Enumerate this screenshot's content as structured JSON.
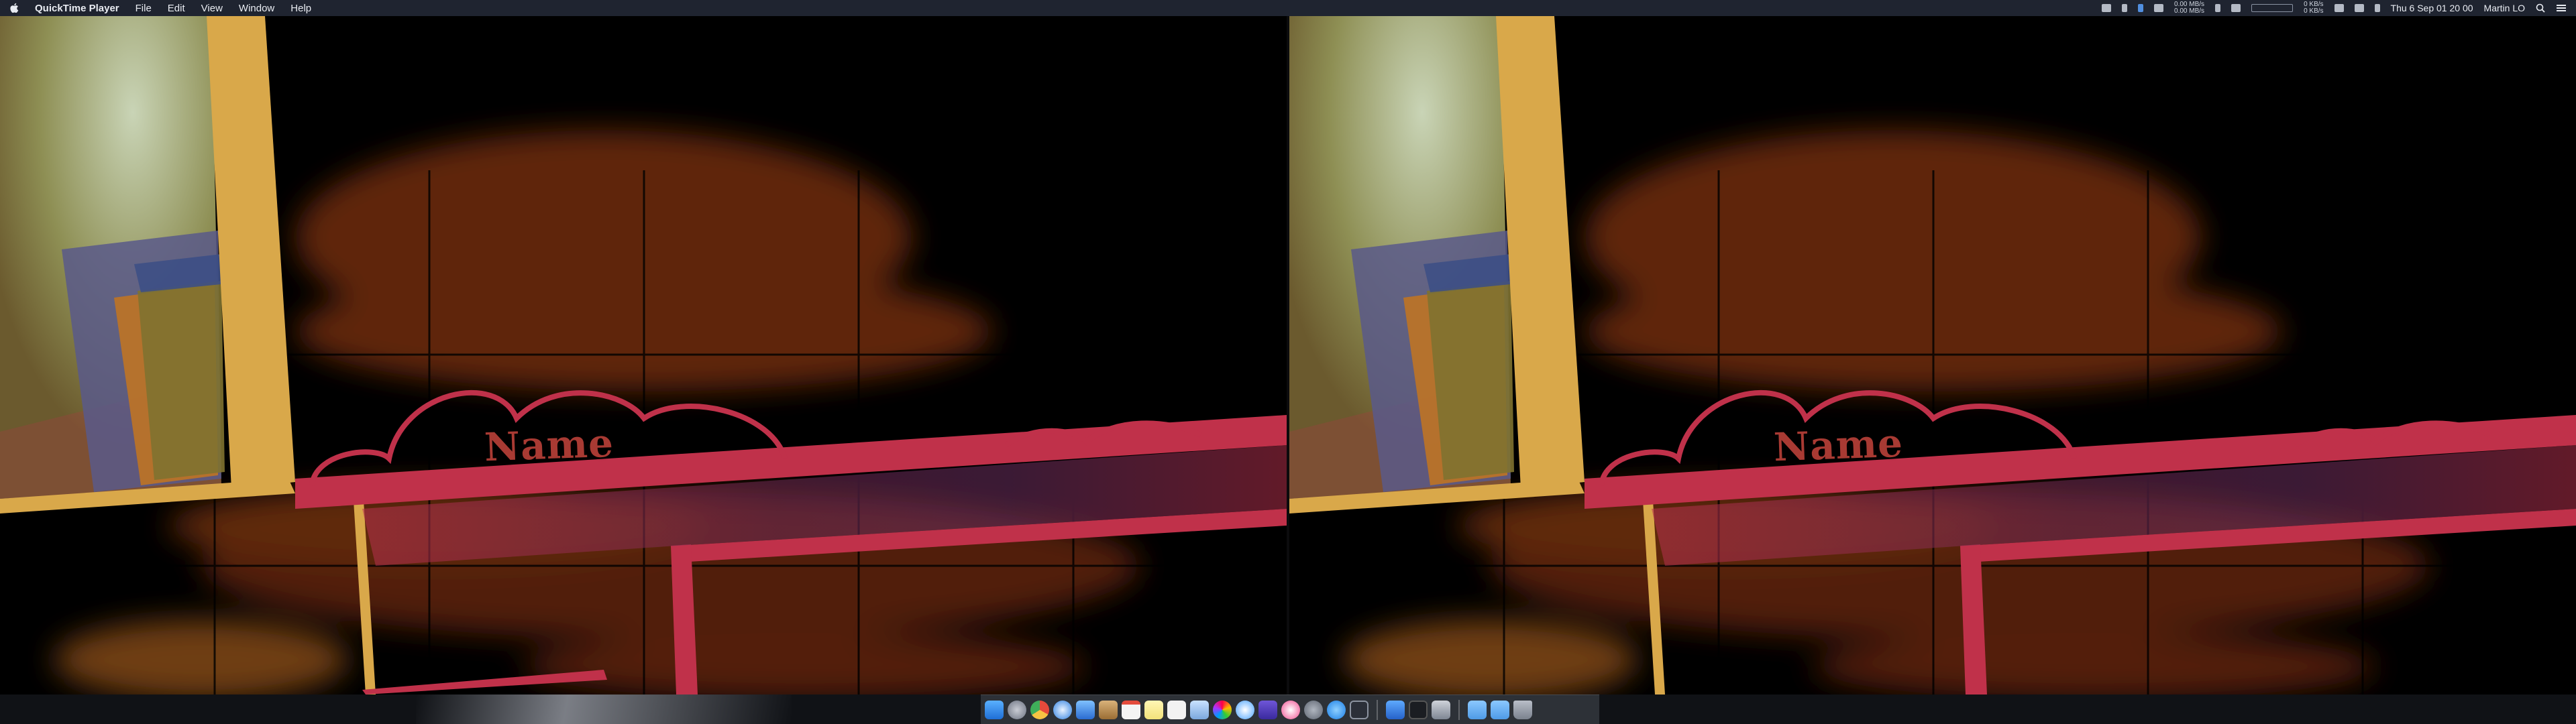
{
  "menubar": {
    "app_name": "QuickTime Player",
    "menus": [
      "File",
      "Edit",
      "View",
      "Window",
      "Help"
    ],
    "net_up": "0.00 MB/s",
    "net_down": "0.00 MB/s",
    "disk_up": "0 KB/s",
    "disk_down": "0 KB/s",
    "datetime": "Thu 6 Sep  01 20 00",
    "user": "Martin LO"
  },
  "video": {
    "name_text": "Name"
  },
  "colors": {
    "menubar_bg": "#1f2430",
    "panel_yellow": "#d9a84a",
    "panel_red": "#c0314a",
    "name_red": "#a83a33"
  },
  "dock": {
    "icons": [
      "finder-icon",
      "launchpad-icon",
      "chrome-icon",
      "safari-icon",
      "mail-icon",
      "contacts-icon",
      "calendar-icon",
      "notes-icon",
      "reminders-icon",
      "preview-icon",
      "photos-icon",
      "messages-icon",
      "imovie-icon",
      "itunes-icon",
      "system-preferences-icon",
      "app-store-icon",
      "activity-monitor-icon",
      "xcode-icon",
      "terminal-icon",
      "quicktime-icon",
      "folder-icon",
      "folder-icon",
      "trash-icon"
    ]
  }
}
